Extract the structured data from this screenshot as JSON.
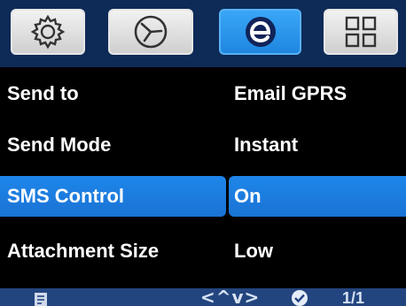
{
  "tabs": [
    {
      "icon": "gear-icon",
      "active": false
    },
    {
      "icon": "clock-icon",
      "active": false
    },
    {
      "icon": "network-e-icon",
      "active": true
    },
    {
      "icon": "grid-icon",
      "active": false
    }
  ],
  "settings": [
    {
      "label": "Send to",
      "value": "Email GPRS",
      "selected": false
    },
    {
      "label": "Send Mode",
      "value": "Instant",
      "selected": false
    },
    {
      "label": "SMS Control",
      "value": "On",
      "selected": true
    },
    {
      "label": "Attachment Size",
      "value": "Low",
      "selected": false
    }
  ],
  "status_bar": {
    "nav_arrows": "<^v>",
    "page": "1/1"
  },
  "colors": {
    "selection": "#1a7ae0",
    "tab_active": "#2a95ee",
    "bar_background": "#0e2a57"
  }
}
